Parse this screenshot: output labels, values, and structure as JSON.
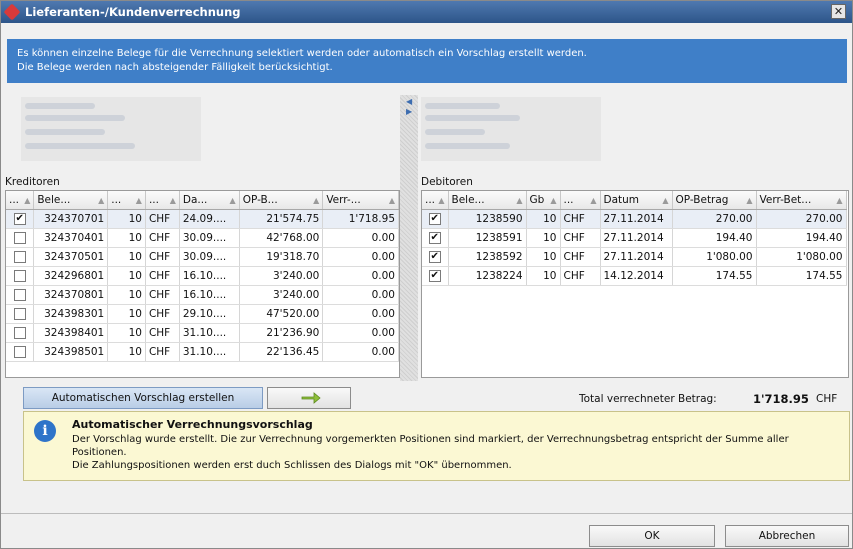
{
  "window": {
    "title": "Lieferanten-/Kundenverrechnung",
    "close_glyph": "✕"
  },
  "banner": {
    "line1": "Es können einzelne Belege für die Verrechnung selektiert werden oder automatisch ein Vorschlag erstellt werden.",
    "line2": "Die Belege werden nach absteigender Fälligkeit berücksichtigt."
  },
  "kreditoren": {
    "label": "Kreditoren",
    "columns": [
      "...",
      "Bele...",
      "...",
      "...",
      "Da...",
      "OP-B...",
      "Verr-..."
    ],
    "rows": [
      {
        "checked": true,
        "beleg": "324370701",
        "n": "10",
        "cur": "CHF",
        "date": "24.09....",
        "op": "21'574.75",
        "verr": "1'718.95"
      },
      {
        "checked": false,
        "beleg": "324370401",
        "n": "10",
        "cur": "CHF",
        "date": "30.09....",
        "op": "42'768.00",
        "verr": "0.00"
      },
      {
        "checked": false,
        "beleg": "324370501",
        "n": "10",
        "cur": "CHF",
        "date": "30.09....",
        "op": "19'318.70",
        "verr": "0.00"
      },
      {
        "checked": false,
        "beleg": "324296801",
        "n": "10",
        "cur": "CHF",
        "date": "16.10....",
        "op": "3'240.00",
        "verr": "0.00"
      },
      {
        "checked": false,
        "beleg": "324370801",
        "n": "10",
        "cur": "CHF",
        "date": "16.10....",
        "op": "3'240.00",
        "verr": "0.00"
      },
      {
        "checked": false,
        "beleg": "324398301",
        "n": "10",
        "cur": "CHF",
        "date": "29.10....",
        "op": "47'520.00",
        "verr": "0.00"
      },
      {
        "checked": false,
        "beleg": "324398401",
        "n": "10",
        "cur": "CHF",
        "date": "31.10....",
        "op": "21'236.90",
        "verr": "0.00"
      },
      {
        "checked": false,
        "beleg": "324398501",
        "n": "10",
        "cur": "CHF",
        "date": "31.10....",
        "op": "22'136.45",
        "verr": "0.00"
      }
    ]
  },
  "debitoren": {
    "label": "Debitoren",
    "columns": [
      "...",
      "Bele...",
      "Gb",
      "...",
      "Datum",
      "OP-Betrag",
      "Verr-Bet..."
    ],
    "rows": [
      {
        "checked": true,
        "beleg": "1238590",
        "n": "10",
        "cur": "CHF",
        "date": "27.11.2014",
        "op": "270.00",
        "verr": "270.00"
      },
      {
        "checked": true,
        "beleg": "1238591",
        "n": "10",
        "cur": "CHF",
        "date": "27.11.2014",
        "op": "194.40",
        "verr": "194.40"
      },
      {
        "checked": true,
        "beleg": "1238592",
        "n": "10",
        "cur": "CHF",
        "date": "27.11.2014",
        "op": "1'080.00",
        "verr": "1'080.00"
      },
      {
        "checked": true,
        "beleg": "1238224",
        "n": "10",
        "cur": "CHF",
        "date": "14.12.2014",
        "op": "174.55",
        "verr": "174.55"
      }
    ]
  },
  "actions": {
    "auto_button": "Automatischen Vorschlag erstellen",
    "apply_icon": "arrow-icon"
  },
  "total": {
    "label": "Total verrechneter Betrag:",
    "value": "1'718.95",
    "currency": "CHF"
  },
  "info": {
    "icon": "i",
    "heading": "Automatischer Verrechnungsvorschlag",
    "line1": "Der Vorschlag wurde erstellt. Die zur Verrechnung vorgemerkten Positionen sind markiert, der Verrechnungsbetrag entspricht der Summe aller",
    "line2": "Positionen.",
    "line3": "Die Zahlungspositionen werden erst duch Schlissen des Dialogs mit \"OK\" übernommen."
  },
  "footer": {
    "ok": "OK",
    "cancel": "Abbrechen"
  },
  "colors": {
    "titlebar": "#2d5589",
    "banner": "#3f7fc8",
    "info_bg": "#fbf8d3",
    "info_icon": "#2e74c9"
  }
}
